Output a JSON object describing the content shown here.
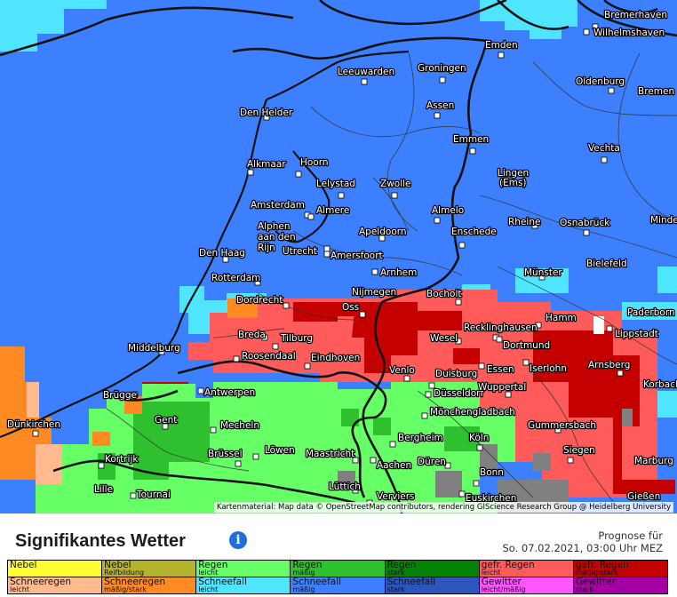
{
  "map": {
    "attribution": "Kartenmaterial: Map data © OpenStreetMap contributors, rendering GIScience Research Group @ Heidelberg University",
    "cities": [
      {
        "name": "Bremerhaven"
      },
      {
        "name": "Wilhelmshaven"
      },
      {
        "name": "Emden"
      },
      {
        "name": "Oldenburg"
      },
      {
        "name": "Bremen"
      },
      {
        "name": "Leeuwarden"
      },
      {
        "name": "Groningen"
      },
      {
        "name": "Assen"
      },
      {
        "name": "Den Helder"
      },
      {
        "name": "Emmen"
      },
      {
        "name": "Vechta"
      },
      {
        "name": "Alkmaar"
      },
      {
        "name": "Hoorn"
      },
      {
        "name": "Lingen"
      },
      {
        "name": "(Ems)"
      },
      {
        "name": "Lelystad"
      },
      {
        "name": "Zwolle"
      },
      {
        "name": "Amsterdam"
      },
      {
        "name": "Almere"
      },
      {
        "name": "Almelo"
      },
      {
        "name": "Rheine"
      },
      {
        "name": "Osnabrück"
      },
      {
        "name": "Minden"
      },
      {
        "name": "Alphen"
      },
      {
        "name": "aan den"
      },
      {
        "name": "Rijn"
      },
      {
        "name": "Apeldoorn"
      },
      {
        "name": "Enschede"
      },
      {
        "name": "Den Haag"
      },
      {
        "name": "Utrecht"
      },
      {
        "name": "Amersfoort"
      },
      {
        "name": "Münster"
      },
      {
        "name": "Bielefeld"
      },
      {
        "name": "Rotterdam"
      },
      {
        "name": "Arnhem"
      },
      {
        "name": "Nijmegen"
      },
      {
        "name": "Bocholt"
      },
      {
        "name": "Dordrecht"
      },
      {
        "name": "Oss"
      },
      {
        "name": "Paderborn"
      },
      {
        "name": "Hamm"
      },
      {
        "name": "Recklinghausen"
      },
      {
        "name": "Breda"
      },
      {
        "name": "Tilburg"
      },
      {
        "name": "Wesel"
      },
      {
        "name": "Lippstadt"
      },
      {
        "name": "Dortmund"
      },
      {
        "name": "Middelburg"
      },
      {
        "name": "Roosendaal"
      },
      {
        "name": "Eindhoven"
      },
      {
        "name": "Arnsberg"
      },
      {
        "name": "Venlo"
      },
      {
        "name": "Essen"
      },
      {
        "name": "Iserlohn"
      },
      {
        "name": "Duisburg"
      },
      {
        "name": "Brügge"
      },
      {
        "name": "Antwerpen"
      },
      {
        "name": "Düsseldorf"
      },
      {
        "name": "Wuppertal"
      },
      {
        "name": "Korbach"
      },
      {
        "name": "Gent"
      },
      {
        "name": "Mönchengladbach"
      },
      {
        "name": "Dünkirchen"
      },
      {
        "name": "Mecheln"
      },
      {
        "name": "Gummersbach"
      },
      {
        "name": "Bergheim"
      },
      {
        "name": "Köln"
      },
      {
        "name": "Löwen"
      },
      {
        "name": "Siegen"
      },
      {
        "name": "Kortrijk"
      },
      {
        "name": "Brüssel"
      },
      {
        "name": "Maastricht"
      },
      {
        "name": "Marburg"
      },
      {
        "name": "Aachen"
      },
      {
        "name": "Düren"
      },
      {
        "name": "Bonn"
      },
      {
        "name": "Lille"
      },
      {
        "name": "Tournai"
      },
      {
        "name": "Lüttich"
      },
      {
        "name": "Verviers"
      },
      {
        "name": "Euskirchen"
      },
      {
        "name": "Gießen"
      }
    ]
  },
  "footer": {
    "title": "Signifikantes Wetter",
    "info_icon": "i",
    "forecast_label": "Prognose für",
    "forecast_time": "So. 07.02.2021, 03:00 Uhr MEZ"
  },
  "legend": {
    "row1": [
      {
        "name": "Nebel",
        "sub": "",
        "color": "#ffff33"
      },
      {
        "name": "Nebel",
        "sub": "Reifbildung",
        "color": "#b5b52d"
      },
      {
        "name": "Regen",
        "sub": "leicht",
        "color": "#66ff66"
      },
      {
        "name": "Regen",
        "sub": "mäßig",
        "color": "#2fc02f"
      },
      {
        "name": "Regen",
        "sub": "stark",
        "color": "#068306"
      },
      {
        "name": "gefr. Regen",
        "sub": "leicht",
        "color": "#ff5b5b"
      },
      {
        "name": "gefr. Regen",
        "sub": "mäßig/stark",
        "color": "#c40000"
      }
    ],
    "row2": [
      {
        "name": "Schneeregen",
        "sub": "leicht",
        "color": "#ffbb8f"
      },
      {
        "name": "Schneeregen",
        "sub": "mäßig/stark",
        "color": "#ff8a24"
      },
      {
        "name": "Schneefall",
        "sub": "leicht",
        "color": "#4fe5ff"
      },
      {
        "name": "Schneefall",
        "sub": "mäßig",
        "color": "#3d80ff"
      },
      {
        "name": "Schneefall",
        "sub": "stark",
        "color": "#2c55bd"
      },
      {
        "name": "Gewitter",
        "sub": "leicht/mäßig",
        "color": "#ff55ff"
      },
      {
        "name": "Gewitter",
        "sub": "stark",
        "color": "#a400a4"
      }
    ]
  }
}
